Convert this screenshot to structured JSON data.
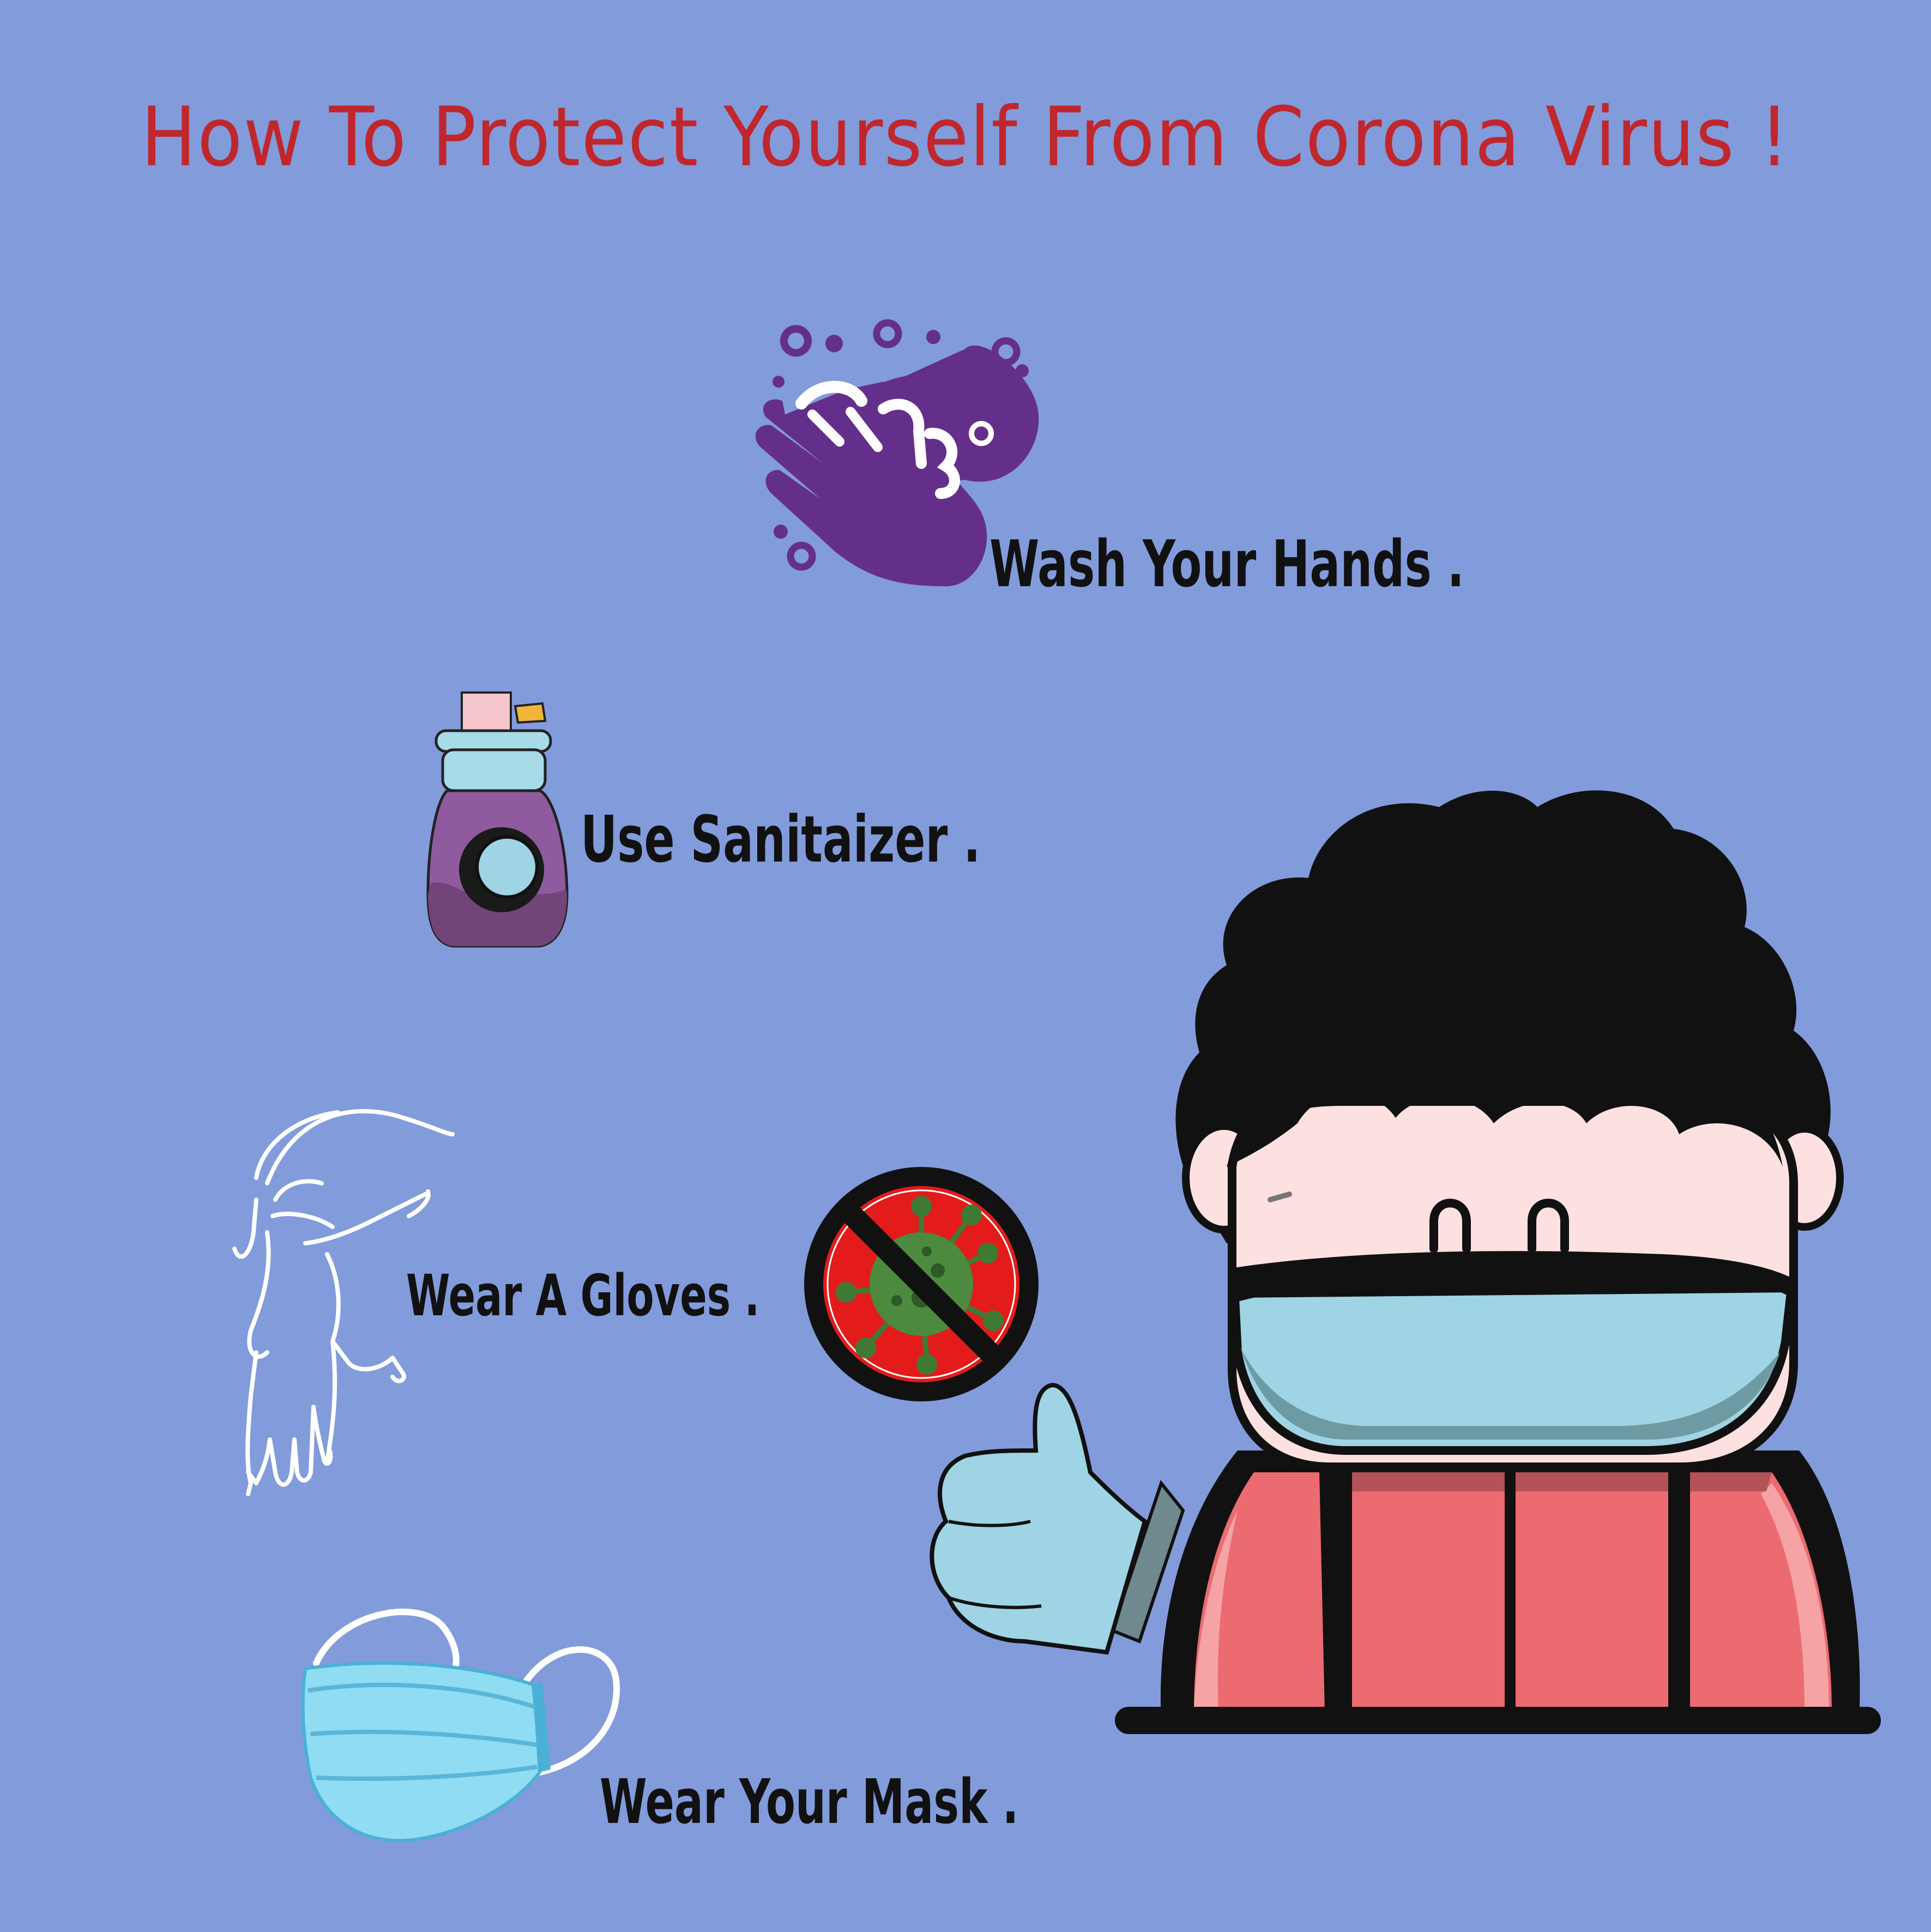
{
  "title": "How To Protect Yourself From Corona Virus !",
  "tips": [
    {
      "label": "Wash Your Hands .",
      "icon": "hand-washing-icon"
    },
    {
      "label": "Use Sanitaizer .",
      "icon": "sanitizer-bottle-icon"
    },
    {
      "label": "Wear A Gloves .",
      "icon": "glove-icon"
    },
    {
      "label": "Wear Your Mask .",
      "icon": "face-mask-icon"
    }
  ],
  "illustrations": {
    "character": "masked-character-thumbs-up",
    "virus_sign": "no-virus-sign-icon"
  },
  "colors": {
    "background": "#829bdb",
    "title": "#c0272d",
    "tip_text": "#111111",
    "hand_icon": "#642f8a",
    "virus_sign_red": "#e31b1b",
    "virus_green": "#3f7a34",
    "mask_blue": "#9fd4e4",
    "jacket": "#eb6b70"
  }
}
